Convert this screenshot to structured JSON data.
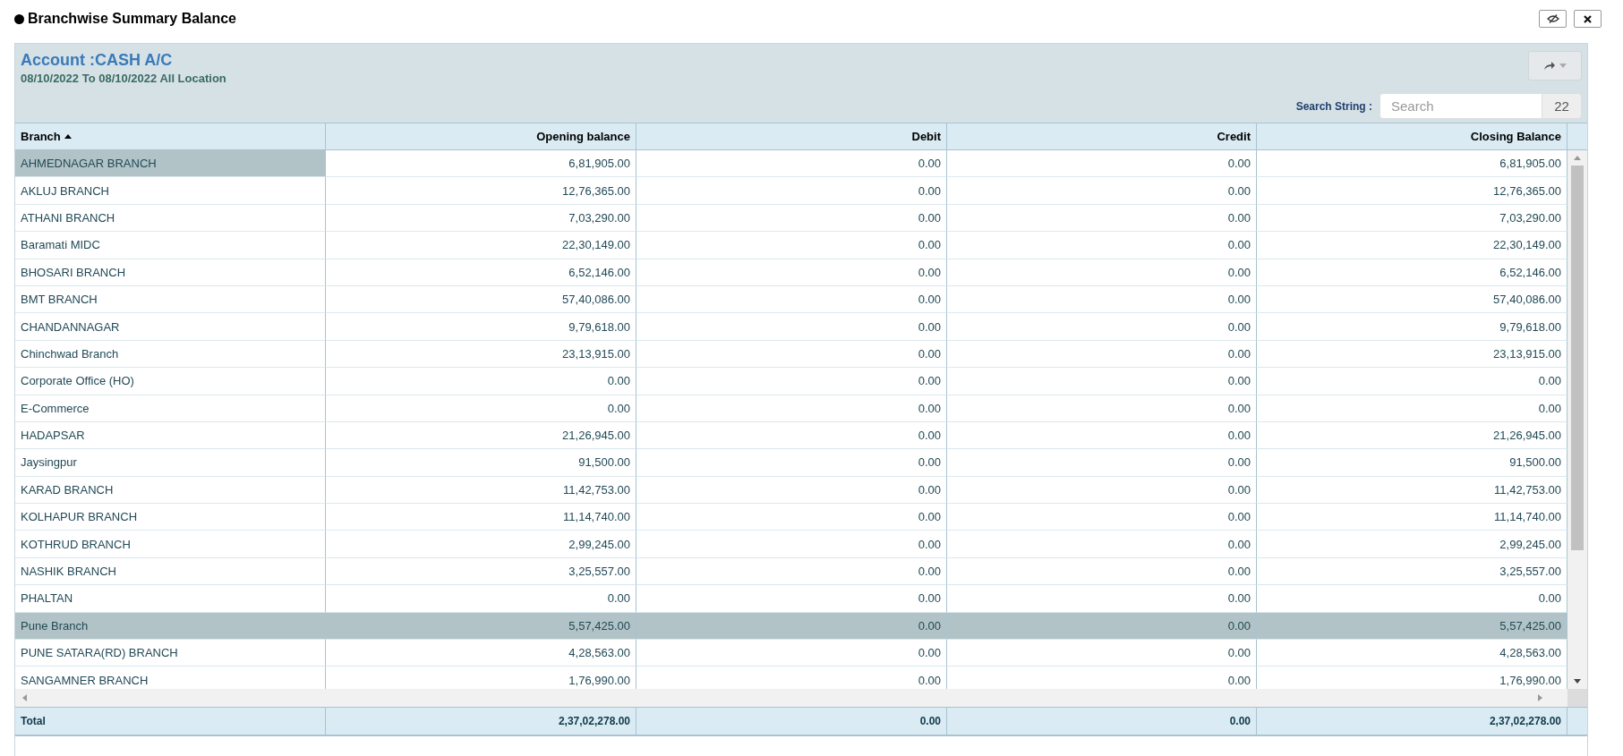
{
  "window": {
    "title": "Branchwise Summary Balance"
  },
  "report": {
    "account": "Account :CASH A/C",
    "period": "08/10/2022 To 08/10/2022 All Location"
  },
  "search": {
    "label": "Search String :",
    "placeholder": "Search",
    "count": "22"
  },
  "table": {
    "columns": [
      {
        "label": "Branch",
        "sorted": true
      },
      {
        "label": "Opening balance",
        "sorted": false
      },
      {
        "label": "Debit",
        "sorted": false
      },
      {
        "label": "Credit",
        "sorted": false
      },
      {
        "label": "Closing Balance",
        "sorted": false
      }
    ],
    "rows": [
      {
        "cells": [
          "AHMEDNAGAR BRANCH",
          "6,81,905.00",
          "0.00",
          "0.00",
          "6,81,905.00"
        ],
        "selected": false,
        "focused": true
      },
      {
        "cells": [
          "AKLUJ BRANCH",
          "12,76,365.00",
          "0.00",
          "0.00",
          "12,76,365.00"
        ],
        "selected": false,
        "focused": false
      },
      {
        "cells": [
          "ATHANI BRANCH",
          "7,03,290.00",
          "0.00",
          "0.00",
          "7,03,290.00"
        ],
        "selected": false,
        "focused": false
      },
      {
        "cells": [
          "Baramati MIDC",
          "22,30,149.00",
          "0.00",
          "0.00",
          "22,30,149.00"
        ],
        "selected": false,
        "focused": false
      },
      {
        "cells": [
          "BHOSARI BRANCH",
          "6,52,146.00",
          "0.00",
          "0.00",
          "6,52,146.00"
        ],
        "selected": false,
        "focused": false
      },
      {
        "cells": [
          "BMT BRANCH",
          "57,40,086.00",
          "0.00",
          "0.00",
          "57,40,086.00"
        ],
        "selected": false,
        "focused": false
      },
      {
        "cells": [
          "CHANDANNAGAR",
          "9,79,618.00",
          "0.00",
          "0.00",
          "9,79,618.00"
        ],
        "selected": false,
        "focused": false
      },
      {
        "cells": [
          "Chinchwad Branch",
          "23,13,915.00",
          "0.00",
          "0.00",
          "23,13,915.00"
        ],
        "selected": false,
        "focused": false
      },
      {
        "cells": [
          "Corporate Office (HO)",
          "0.00",
          "0.00",
          "0.00",
          "0.00"
        ],
        "selected": false,
        "focused": false
      },
      {
        "cells": [
          "E-Commerce",
          "0.00",
          "0.00",
          "0.00",
          "0.00"
        ],
        "selected": false,
        "focused": false
      },
      {
        "cells": [
          "HADAPSAR",
          "21,26,945.00",
          "0.00",
          "0.00",
          "21,26,945.00"
        ],
        "selected": false,
        "focused": false
      },
      {
        "cells": [
          "Jaysingpur",
          "91,500.00",
          "0.00",
          "0.00",
          "91,500.00"
        ],
        "selected": false,
        "focused": false
      },
      {
        "cells": [
          "KARAD BRANCH",
          "11,42,753.00",
          "0.00",
          "0.00",
          "11,42,753.00"
        ],
        "selected": false,
        "focused": false
      },
      {
        "cells": [
          "KOLHAPUR BRANCH",
          "11,14,740.00",
          "0.00",
          "0.00",
          "11,14,740.00"
        ],
        "selected": false,
        "focused": false
      },
      {
        "cells": [
          "KOTHRUD BRANCH",
          "2,99,245.00",
          "0.00",
          "0.00",
          "2,99,245.00"
        ],
        "selected": false,
        "focused": false
      },
      {
        "cells": [
          "NASHIK BRANCH",
          "3,25,557.00",
          "0.00",
          "0.00",
          "3,25,557.00"
        ],
        "selected": false,
        "focused": false
      },
      {
        "cells": [
          "PHALTAN",
          "0.00",
          "0.00",
          "0.00",
          "0.00"
        ],
        "selected": false,
        "focused": false
      },
      {
        "cells": [
          "Pune Branch",
          "5,57,425.00",
          "0.00",
          "0.00",
          "5,57,425.00"
        ],
        "selected": true,
        "focused": false
      },
      {
        "cells": [
          "PUNE SATARA(RD) BRANCH",
          "4,28,563.00",
          "0.00",
          "0.00",
          "4,28,563.00"
        ],
        "selected": false,
        "focused": false
      },
      {
        "cells": [
          "SANGAMNER BRANCH",
          "1,76,990.00",
          "0.00",
          "0.00",
          "1,76,990.00"
        ],
        "selected": false,
        "focused": false
      }
    ],
    "total": [
      "Total",
      "2,37,02,278.00",
      "0.00",
      "0.00",
      "2,37,02,278.00"
    ]
  }
}
